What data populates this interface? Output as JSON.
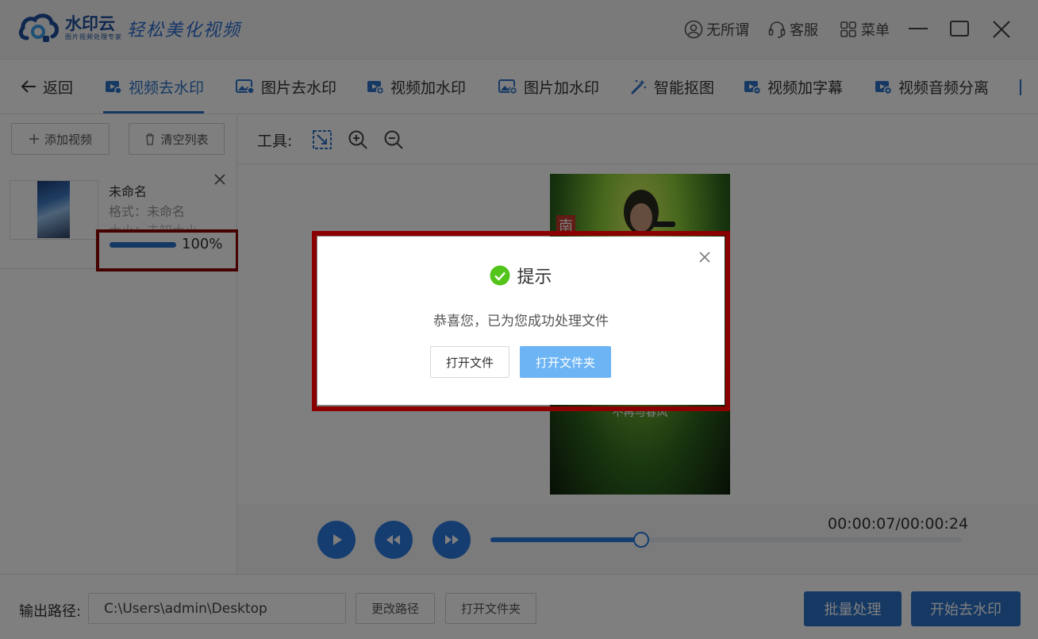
{
  "app": {
    "name": "水印云",
    "subtitle": "图片视频处理专家",
    "slogan": "轻松美化视频"
  },
  "titlebar": {
    "user_label": "无所谓",
    "service_label": "客服",
    "menu_label": "菜单"
  },
  "nav": {
    "back_label": "返回",
    "items": [
      {
        "label": "视频去水印",
        "icon": "video-icon"
      },
      {
        "label": "图片去水印",
        "icon": "image-icon"
      },
      {
        "label": "视频加水印",
        "icon": "video-add-icon"
      },
      {
        "label": "图片加水印",
        "icon": "image-add-icon"
      },
      {
        "label": "智能抠图",
        "icon": "magic-wand-icon"
      },
      {
        "label": "视频加字幕",
        "icon": "video-subtitle-icon"
      },
      {
        "label": "视频音频分离",
        "icon": "video-audio-icon"
      }
    ]
  },
  "left": {
    "add_video_label": "添加视频",
    "clear_list_label": "清空列表",
    "file": {
      "name": "未命名",
      "format": "格式：未命名",
      "size": "大小：未知大小",
      "progress": 1.0,
      "progress_text": "100%"
    }
  },
  "tools": {
    "label": "工具:"
  },
  "video": {
    "caption": "不再与春风",
    "badge": "南"
  },
  "playback": {
    "time": "00:00:07/00:00:24",
    "position": 0.32
  },
  "bottom": {
    "output_label": "输出路径:",
    "output_path": "C:\\Users\\admin\\Desktop",
    "change_path_label": "更改路径",
    "open_folder_label": "打开文件夹",
    "batch_label": "批量处理",
    "start_label": "开始去水印"
  },
  "dialog": {
    "title": "提示",
    "message": "恭喜您，已为您成功处理文件",
    "open_file_label": "打开文件",
    "open_folder_label": "打开文件夹"
  },
  "colors": {
    "accent": "#2d73c9",
    "highlight": "#8a0000",
    "success": "#52c41a"
  }
}
